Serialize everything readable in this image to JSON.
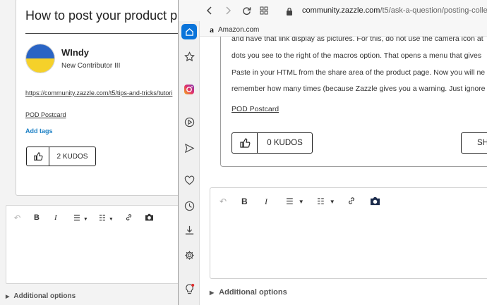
{
  "back_window": {
    "title": "How to post your product pics",
    "author": "WIndy",
    "rank": "New Contributor III",
    "link": "https://community.zazzle.com/t5/tips-and-tricks/tutori",
    "label": "POD Postcard",
    "add_tags": "Add tags",
    "kudos": "2 KUDOS",
    "editor_tools": [
      "undo-icon",
      "bold-icon",
      "italic-icon",
      "bullet-list-icon",
      "numbered-list-icon",
      "link-icon",
      "camera-icon"
    ],
    "bold": "B",
    "italic": "I",
    "additional_options": "Additional options"
  },
  "browser": {
    "url_domain": "community.zazzle.com",
    "url_path": "/t5/ask-a-question/posting-colle",
    "bookmark": "Amazon.com",
    "bookmark_logo": "a",
    "sidebar_icons": [
      "home-icon",
      "star-icon",
      "instagram-icon",
      "play-icon",
      "send-icon",
      "heart-icon",
      "clock-icon",
      "download-icon",
      "settings-icon",
      "lightbulb-icon"
    ],
    "accent_color": "#0a74da"
  },
  "post": {
    "lines": [
      "and have that link display as pictures. For this, do not use the camera icon at",
      "dots you see to the right of the macros option. That opens a menu that gives",
      "Paste in your HTML from the share area of the product page. Now you will ne",
      "remember how many times (because Zazzle gives you a warning. Just ignore"
    ],
    "label": "POD Postcard",
    "kudos": "0 KUDOS",
    "share": "SH"
  },
  "editor": {
    "bold": "B",
    "italic": "I",
    "additional_options": "Additional options"
  }
}
